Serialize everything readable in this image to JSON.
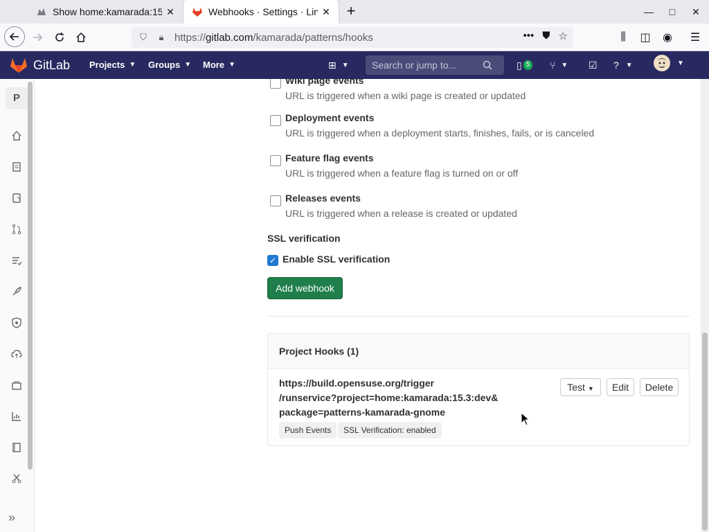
{
  "browser": {
    "tabs": [
      {
        "title": "Show home:kamarada:15",
        "active": false
      },
      {
        "title": "Webhooks · Settings · Lin",
        "active": true
      }
    ],
    "url_prefix": "https://",
    "url_domain": "gitlab.com",
    "url_path": "/kamarada/patterns/hooks"
  },
  "gitlab_header": {
    "brand": "GitLab",
    "nav": [
      "Projects",
      "Groups",
      "More"
    ],
    "search_placeholder": "Search or jump to...",
    "issues_badge": "5"
  },
  "sidebar": {
    "project_initial": "P",
    "items": [
      "home-icon",
      "repository-icon",
      "issues-icon",
      "merge-requests-icon",
      "requirements-icon",
      "ci-cd-icon",
      "security-icon",
      "deployments-icon",
      "packages-icon",
      "analytics-icon",
      "wiki-icon",
      "snippets-icon"
    ]
  },
  "events": [
    {
      "label": "Wiki page events",
      "help": "URL is triggered when a wiki page is created or updated"
    },
    {
      "label": "Deployment events",
      "help": "URL is triggered when a deployment starts, finishes, fails, or is canceled"
    },
    {
      "label": "Feature flag events",
      "help": "URL is triggered when a feature flag is turned on or off"
    },
    {
      "label": "Releases events",
      "help": "URL is triggered when a release is created or updated"
    }
  ],
  "ssl": {
    "title": "SSL verification",
    "checkbox_label": "Enable SSL verification",
    "checked": true
  },
  "add_button": "Add webhook",
  "project_hooks": {
    "title": "Project Hooks (1)",
    "hook": {
      "url_line1": "https://build.opensuse.org/trigger",
      "url_line2": "/runservice?project=home:kamarada:15.3:dev&",
      "url_line3": "package=patterns-kamarada-gnome",
      "tags": [
        "Push Events",
        "SSL Verification: enabled"
      ],
      "actions": {
        "test": "Test",
        "edit": "Edit",
        "delete": "Delete"
      }
    }
  },
  "colors": {
    "header_bg": "#292961",
    "primary_green": "#1f7e4a",
    "checkbox_blue": "#1f78d1"
  }
}
